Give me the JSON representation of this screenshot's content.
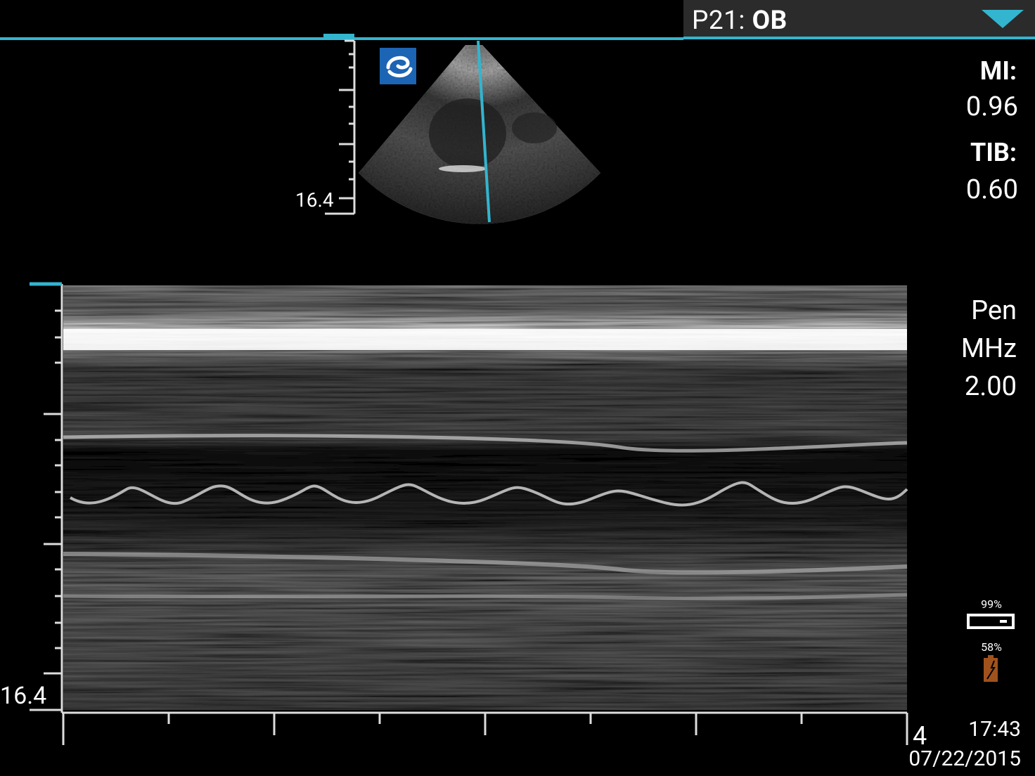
{
  "header": {
    "probe": "P21:",
    "preset": "OB"
  },
  "icons": {
    "logo": "sonosite-logo-icon",
    "dropdown": "triangle-down-icon",
    "usb": "usb-drive-icon",
    "battery": "battery-icon"
  },
  "colors": {
    "accent": "#33b5cf",
    "bar": "#2b2b2b",
    "battery": "#a0521d"
  },
  "params": {
    "mi_label": "MI:",
    "mi_value": "0.96",
    "tib_label": "TIB:",
    "tib_value": "0.60",
    "optimization": "Pen",
    "freq_unit": "MHz",
    "freq_value": "2.00"
  },
  "status": {
    "storage_pct": "99%",
    "battery_pct": "58%",
    "time": "17:43",
    "date": "07/22/2015"
  },
  "twod_image": {
    "depth_label": "16.4"
  },
  "mmode": {
    "depth_label": "16.4",
    "time_scale_label": "4"
  }
}
